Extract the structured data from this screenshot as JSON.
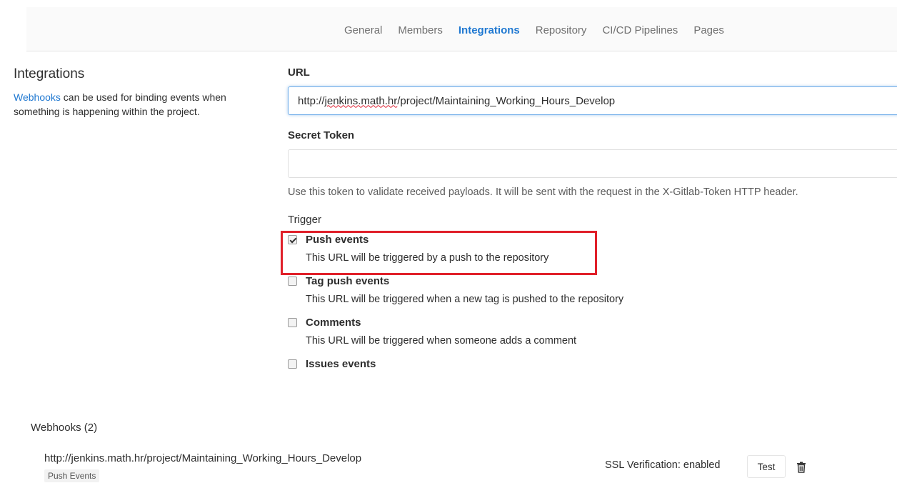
{
  "nav": {
    "tabs": [
      {
        "label": "General",
        "active": false
      },
      {
        "label": "Members",
        "active": false
      },
      {
        "label": "Integrations",
        "active": true
      },
      {
        "label": "Repository",
        "active": false
      },
      {
        "label": "CI/CD Pipelines",
        "active": false
      },
      {
        "label": "Pages",
        "active": false
      }
    ]
  },
  "sidebar": {
    "title": "Integrations",
    "link_text": "Webhooks",
    "description": " can be used for binding events when something is happening within the project."
  },
  "form": {
    "url_label": "URL",
    "url_value_prefix": "http://",
    "url_value_underlined": "jenkins.math.hr",
    "url_value_suffix": "/project/Maintaining_Working_Hours_Develop",
    "secret_label": "Secret Token",
    "secret_value": "",
    "secret_help": "Use this token to validate received payloads. It will be sent with the request in the X-Gitlab-Token HTTP header.",
    "trigger_label": "Trigger",
    "triggers": [
      {
        "label": "Push events",
        "help": "This URL will be triggered by a push to the repository",
        "checked": true
      },
      {
        "label": "Tag push events",
        "help": "This URL will be triggered when a new tag is pushed to the repository",
        "checked": false
      },
      {
        "label": "Comments",
        "help": "This URL will be triggered when someone adds a comment",
        "checked": false
      },
      {
        "label": "Issues events",
        "help": "",
        "checked": false
      }
    ]
  },
  "webhooks": {
    "title": "Webhooks (2)",
    "items": [
      {
        "url": "http://jenkins.math.hr/project/Maintaining_Working_Hours_Develop",
        "badge": "Push Events",
        "ssl": "SSL Verification: enabled",
        "test_label": "Test",
        "delete_icon": "trash-icon"
      }
    ]
  },
  "colors": {
    "accent": "#1f78d1",
    "highlight": "#e0202a"
  }
}
